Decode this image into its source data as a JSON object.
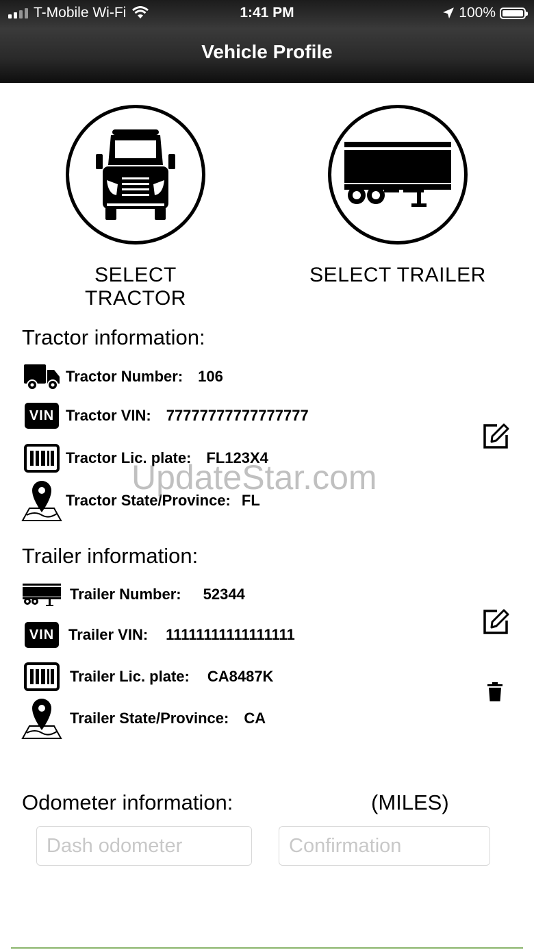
{
  "status_bar": {
    "carrier": "T-Mobile Wi-Fi",
    "time": "1:41 PM",
    "battery": "100%"
  },
  "header": {
    "title": "Vehicle Profile"
  },
  "select": {
    "tractor_label": "SELECT TRACTOR",
    "trailer_label": "SELECT TRAILER"
  },
  "tractor": {
    "section_title": "Tractor information:",
    "number_label": "Tractor Number:",
    "number_value": "106",
    "vin_label": "Tractor VIN:",
    "vin_value": "77777777777777777",
    "plate_label": "Tractor Lic. plate:",
    "plate_value": "FL123X4",
    "state_label": "Tractor State/Province:",
    "state_value": "FL"
  },
  "trailer": {
    "section_title": "Trailer information:",
    "number_label": "Trailer Number:",
    "number_value": "52344",
    "vin_label": "Trailer VIN:",
    "vin_value": "11111111111111111",
    "plate_label": "Trailer Lic. plate:",
    "plate_value": "CA8487K",
    "state_label": "Trailer State/Province:",
    "state_value": "CA"
  },
  "icons": {
    "vin_badge_text": "VIN"
  },
  "odometer": {
    "section_title": "Odometer information:",
    "unit": "(MILES)",
    "dash_placeholder": "Dash odometer",
    "confirm_placeholder": "Confirmation"
  },
  "watermark": "UpdateStar.com",
  "colors": {
    "accent_line": "#8ab56b",
    "header_dark": "#1c1c1c"
  }
}
